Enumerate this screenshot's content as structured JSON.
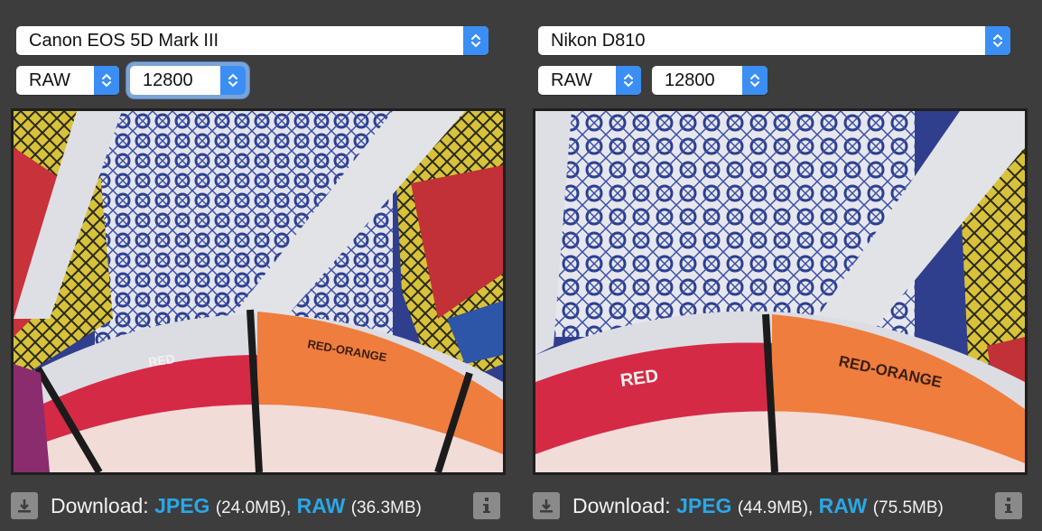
{
  "colors": {
    "background": "#3d3d3d",
    "accent": "#3b8ef4",
    "link": "#2aa7e6",
    "icon_bg": "#8a8a8a"
  },
  "panels": [
    {
      "camera": "Canon EOS 5D Mark III",
      "format": "RAW",
      "iso": "12800",
      "iso_focused": true,
      "image": {
        "label_red": "RED",
        "label_red_orange": "RED-ORANGE"
      },
      "download": {
        "label": "Download:",
        "jpeg_label": "JPEG",
        "jpeg_size": "(24.0MB),",
        "raw_label": "RAW",
        "raw_size": "(36.3MB)"
      }
    },
    {
      "camera": "Nikon D810",
      "format": "RAW",
      "iso": "12800",
      "iso_focused": false,
      "image": {
        "label_red": "RED",
        "label_red_orange": "RED-ORANGE"
      },
      "download": {
        "label": "Download:",
        "jpeg_label": "JPEG",
        "jpeg_size": "(44.9MB),",
        "raw_label": "RAW",
        "raw_size": "(75.5MB)"
      }
    }
  ]
}
